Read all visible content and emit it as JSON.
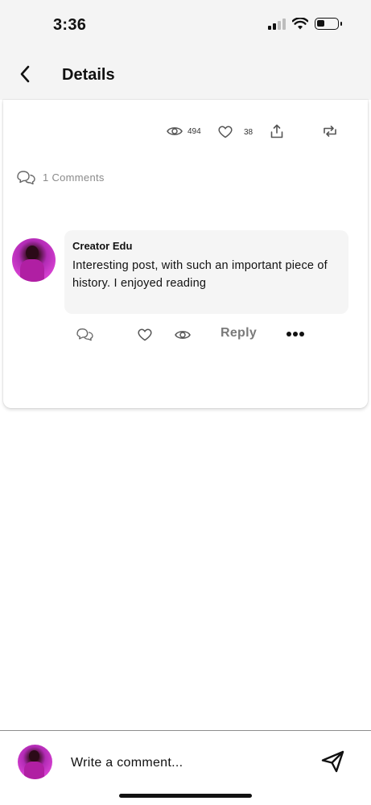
{
  "status_bar": {
    "time": "3:36",
    "icons": [
      "signal-icon",
      "wifi-icon",
      "battery-icon"
    ]
  },
  "header": {
    "back_icon": "chevron-left-icon",
    "title": "Details"
  },
  "post": {
    "stats": {
      "views": "494",
      "likes": "38",
      "icons": [
        "eye-icon",
        "heart-icon",
        "share-icon",
        "repost-icon"
      ]
    },
    "comments_label": "1 Comments"
  },
  "comment": {
    "author": "Creator Edu",
    "text": "Interesting post, with such an important piece of history. I enjoyed reading",
    "actions": {
      "reply_label": "Reply",
      "icons": [
        "comments-icon",
        "heart-icon",
        "eye-icon",
        "more-icon"
      ]
    }
  },
  "composer": {
    "placeholder": "Write a comment...",
    "send_icon": "send-icon"
  },
  "colors": {
    "header_bg": "#f4f4f4",
    "bubble_bg": "#f5f5f5",
    "muted_text": "#8a8a8a",
    "avatar_accent": "#c22ec0"
  }
}
